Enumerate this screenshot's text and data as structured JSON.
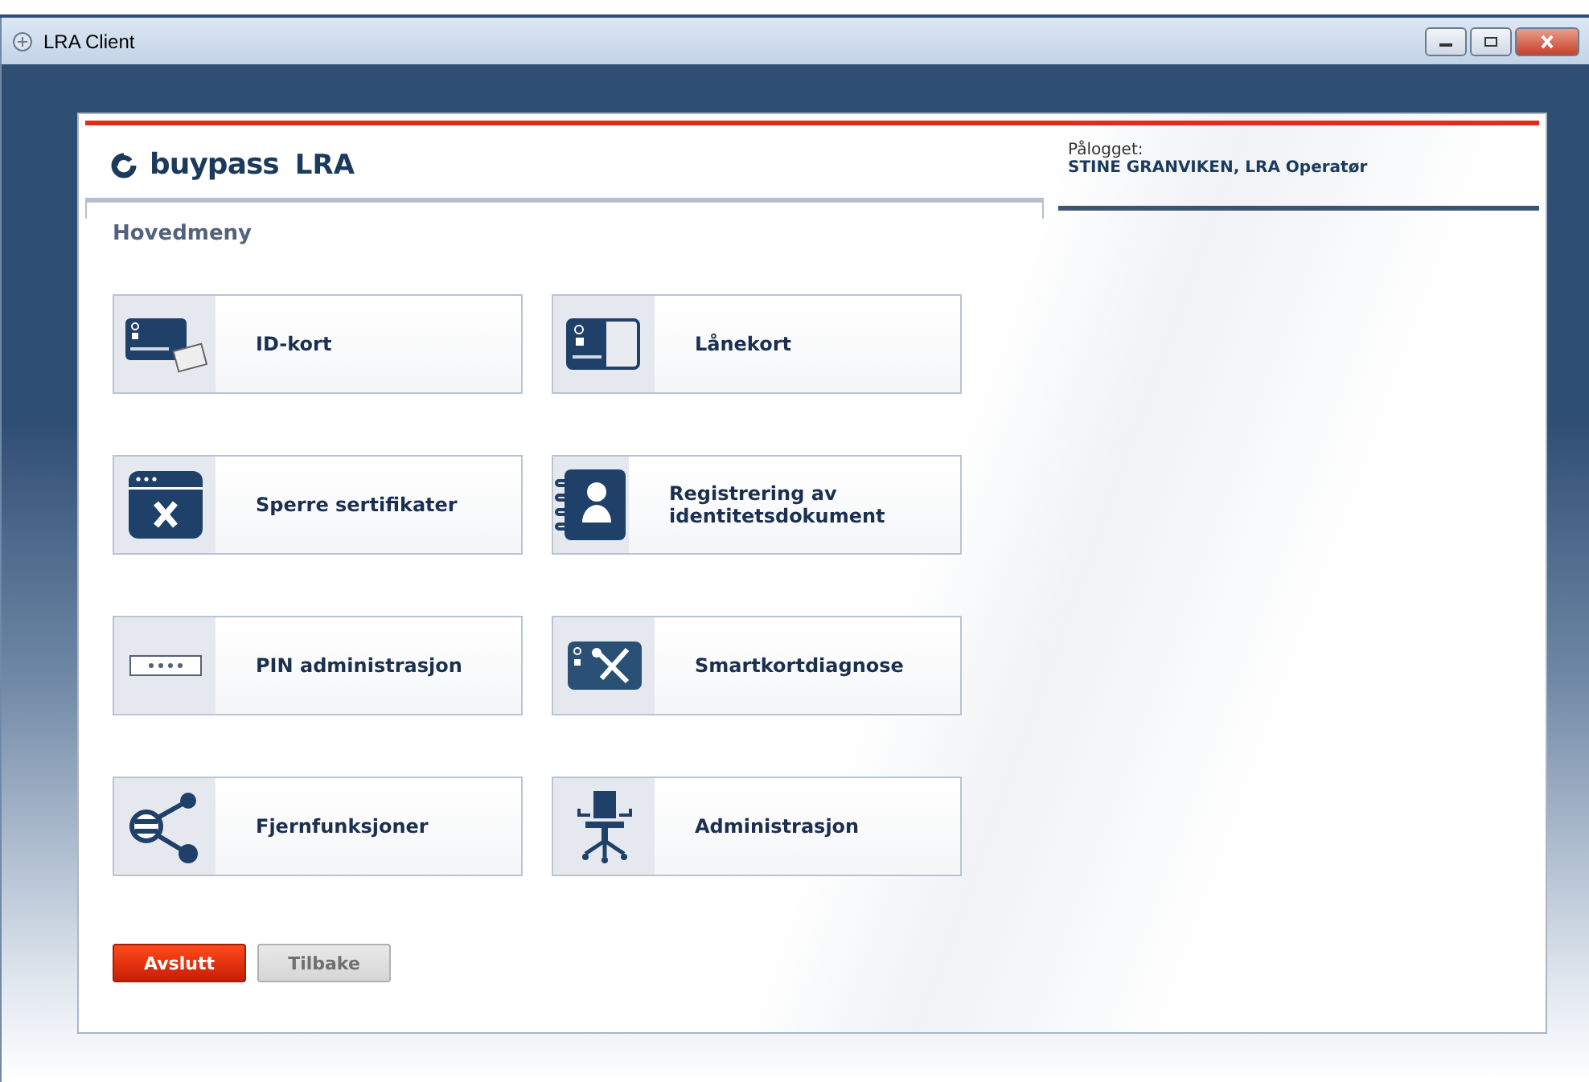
{
  "window": {
    "title": "LRA Client"
  },
  "header": {
    "logo": "buypass",
    "product": "LRA",
    "login_label": "Pålogget:",
    "user": "STINE GRANVIKEN,  LRA Operatør"
  },
  "menu_title": "Hovedmeny",
  "tiles": [
    {
      "kind": "id-card",
      "label": "ID-kort"
    },
    {
      "kind": "loan-card",
      "label": "Lånekort"
    },
    {
      "kind": "revoke",
      "label": "Sperre sertifikater"
    },
    {
      "kind": "register",
      "label": "Registrering av identitetsdokument"
    },
    {
      "kind": "pin",
      "label": "PIN administrasjon"
    },
    {
      "kind": "diagnose",
      "label": "Smartkortdiagnose"
    },
    {
      "kind": "remote",
      "label": "Fjernfunksjoner"
    },
    {
      "kind": "admin",
      "label": "Administrasjon"
    }
  ],
  "buttons": [
    {
      "label": "Avslutt",
      "disabled": false
    },
    {
      "label": "Tilbake",
      "disabled": true
    }
  ]
}
